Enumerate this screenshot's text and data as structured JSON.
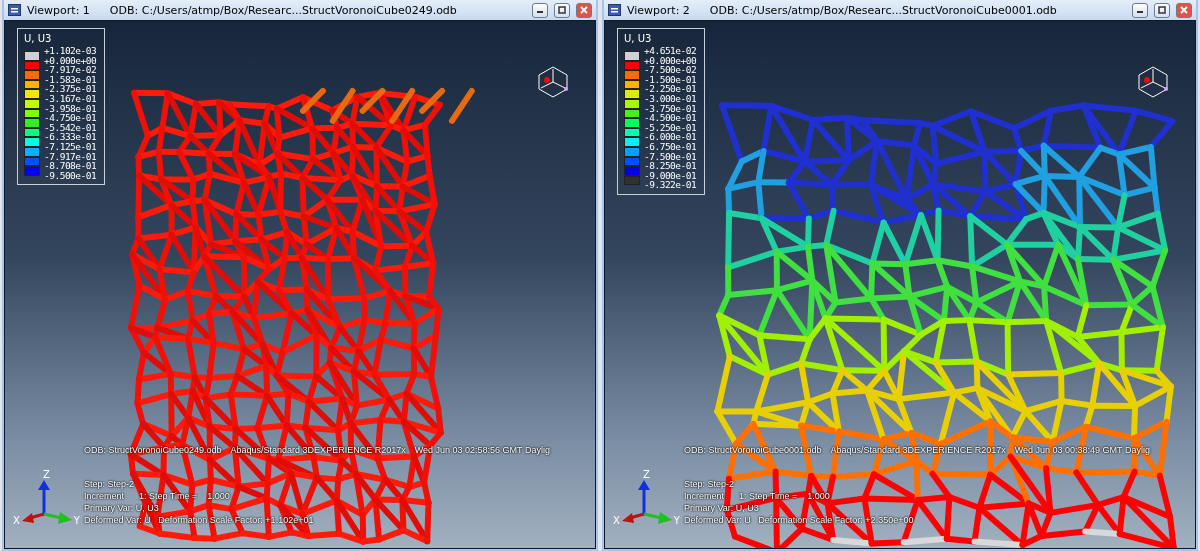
{
  "viewports": [
    {
      "title": "Viewport: 1",
      "odb_path": "ODB: C:/Users/atmp/Box/Researc...StructVoronoiCube0249.odb",
      "legend": {
        "title": "U, U3",
        "labels": [
          "+1.102e-03",
          "+0.000e+00",
          "-7.917e-02",
          "-1.583e-01",
          "-2.375e-01",
          "-3.167e-01",
          "-3.958e-01",
          "-4.750e-01",
          "-5.542e-01",
          "-6.333e-01",
          "-7.125e-01",
          "-7.917e-01",
          "-8.708e-01",
          "-9.500e-01"
        ],
        "bands": [
          {
            "color": "#d0d0d0"
          },
          {
            "color": "#ff0000"
          },
          {
            "color": "#ff6a00"
          },
          {
            "color": "#ffb000"
          },
          {
            "color": "#f0e800"
          },
          {
            "color": "#c0ff00"
          },
          {
            "color": "#80ff00"
          },
          {
            "color": "#30f020"
          },
          {
            "color": "#00ff80"
          },
          {
            "color": "#00ffe0"
          },
          {
            "color": "#00b0ff"
          },
          {
            "color": "#0050ff"
          },
          {
            "color": "#0000f0"
          }
        ]
      },
      "info": {
        "odb": "ODB: StructVoronoiCube0249.odb",
        "solver": "Abaqus/Standard 3DEXPERIENCE R2017x",
        "date": "Wed Jun 03 02:58:56 GMT Daylig",
        "lines": [
          "Step: Step-2",
          "Increment      1: Step Time =    1.000",
          "Primary Var: U, U3",
          "Deformed Var: U   Deformation Scale Factor: +1.102e+01"
        ]
      },
      "triad": {
        "x": "X",
        "y": "Y",
        "z": "Z"
      }
    },
    {
      "title": "Viewport: 2",
      "odb_path": "ODB: C:/Users/atmp/Box/Researc...StructVoronoiCube0001.odb",
      "legend": {
        "title": "U, U3",
        "labels": [
          "+4.651e-02",
          "+0.000e+00",
          "-7.500e-02",
          "-1.500e-01",
          "-2.250e-01",
          "-3.000e-01",
          "-3.750e-01",
          "-4.500e-01",
          "-5.250e-01",
          "-6.000e-01",
          "-6.750e-01",
          "-7.500e-01",
          "-8.250e-01",
          "-9.000e-01",
          "-9.322e-01"
        ],
        "bands": [
          {
            "color": "#d0d0d0"
          },
          {
            "color": "#ff0000"
          },
          {
            "color": "#ff6a00"
          },
          {
            "color": "#ffb000"
          },
          {
            "color": "#d8f000"
          },
          {
            "color": "#a0ff00"
          },
          {
            "color": "#40f020"
          },
          {
            "color": "#00ff60"
          },
          {
            "color": "#00ffb0"
          },
          {
            "color": "#00f0ff"
          },
          {
            "color": "#00a0ff"
          },
          {
            "color": "#0050ff"
          },
          {
            "color": "#0000e0"
          },
          {
            "color": "#303030"
          }
        ]
      },
      "info": {
        "odb": "ODB: StructVoronoiCube0001.odb",
        "solver": "Abaqus/Standard 3DEXPERIENCE R2017x",
        "date": "Wed Jun 03 00:38:49 GMT Daylig",
        "lines": [
          "Step: Step-2",
          "Increment      1: Step Time =    1.000",
          "Primary Var: U, U3",
          "Deformed Var: U   Deformation Scale Factor: +2.350e+00"
        ]
      },
      "triad": {
        "x": "X",
        "y": "Y",
        "z": "Z"
      }
    }
  ]
}
